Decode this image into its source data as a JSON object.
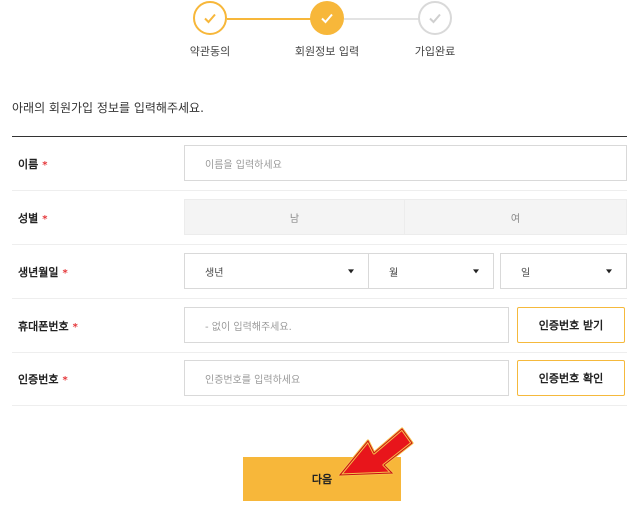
{
  "stepper": {
    "steps": [
      {
        "label": "약관동의",
        "status": "done"
      },
      {
        "label": "회원정보 입력",
        "status": "current"
      },
      {
        "label": "가입완료",
        "status": "pending"
      }
    ],
    "colors": {
      "accent": "#f7b73a",
      "pending": "#d9d9d9"
    }
  },
  "intro": "아래의 회원가입 정보를 입력해주세요.",
  "form": {
    "required_mark": "*",
    "name": {
      "label": "이름",
      "placeholder": "이름을 입력하세요"
    },
    "gender": {
      "label": "성별",
      "options": [
        "남",
        "여"
      ]
    },
    "birth": {
      "label": "생년월일",
      "year": "생년",
      "month": "월",
      "day": "일"
    },
    "phone": {
      "label": "휴대폰번호",
      "placeholder": "- 없이 입력해주세요.",
      "button": "인증번호 받기"
    },
    "code": {
      "label": "인증번호",
      "placeholder": "인증번호를 입력하세요",
      "button": "인증번호 확인"
    }
  },
  "next_button": "다음",
  "annotation": {
    "icon": "red-arrow-icon",
    "color": "#e8151b"
  }
}
